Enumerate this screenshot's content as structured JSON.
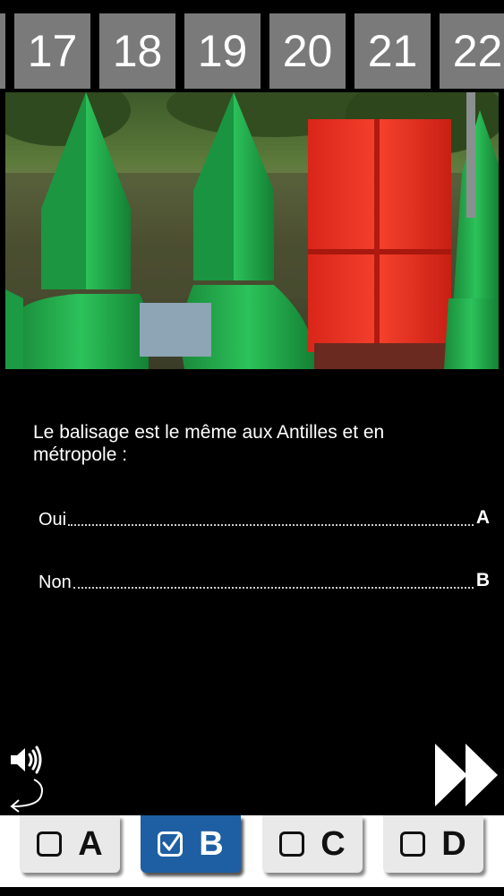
{
  "question_strip": {
    "numbers": [
      "17",
      "18",
      "19",
      "20",
      "21",
      "22"
    ]
  },
  "question": {
    "text": "Le balisage est le même aux Antilles et en métropole :"
  },
  "answers": [
    {
      "text": "Oui",
      "letter": "A"
    },
    {
      "text": "Non",
      "letter": "B"
    }
  ],
  "answer_buttons": [
    {
      "letter": "A",
      "checked": false
    },
    {
      "letter": "B",
      "checked": true
    },
    {
      "letter": "C",
      "checked": false
    },
    {
      "letter": "D",
      "checked": false
    }
  ],
  "colors": {
    "selected_button": "#1e5fa3",
    "tab_gray": "#7a7a7a",
    "buoy_green": "#21a247",
    "buoy_red": "#e8321f"
  },
  "icons": {
    "speaker": "speaker-icon",
    "back": "back-arrow-icon",
    "next": "fast-forward-icon",
    "checkbox": "checkbox-icon"
  }
}
